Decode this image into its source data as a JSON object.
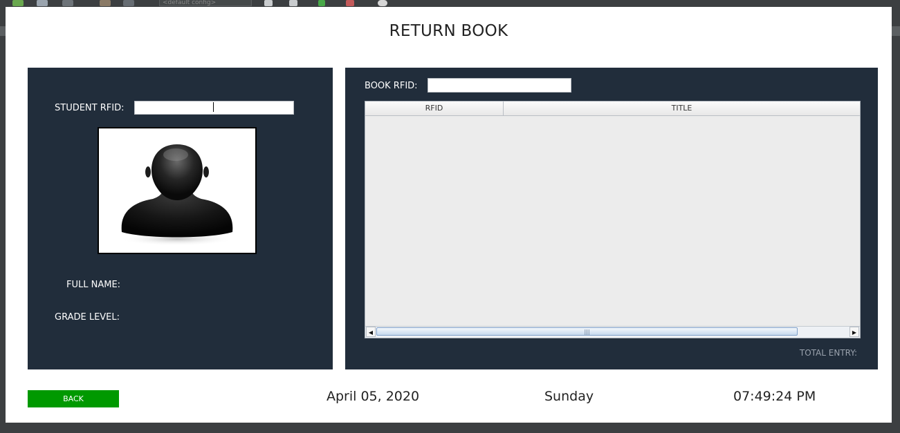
{
  "ide": {
    "config_combo": "<default config>",
    "icons": [
      "new-file-icon",
      "open-project-icon",
      "save-icon",
      "undo-icon",
      "redo-icon",
      "build-icon",
      "clean-build-icon",
      "run-icon",
      "debug-icon",
      "profile-icon"
    ]
  },
  "window": {
    "title": "RETURN BOOK"
  },
  "student_panel": {
    "rfid_label": "STUDENT RFID:",
    "rfid_value": "",
    "photo": "student-avatar-placeholder",
    "full_name_label": "FULL NAME:",
    "full_name_value": "",
    "grade_level_label": "GRADE LEVEL:",
    "grade_level_value": ""
  },
  "book_panel": {
    "rfid_label": "BOOK RFID:",
    "rfid_value": "",
    "table": {
      "columns": [
        "RFID",
        "TITLE"
      ],
      "rows": []
    },
    "total_entry_label": "TOTAL ENTRY:",
    "total_entry_value": ""
  },
  "footer": {
    "back_label": "BACK",
    "date": "April 05, 2020",
    "day": "Sunday",
    "time": "07:49:24 PM"
  },
  "colors": {
    "panel_bg": "#212d3b",
    "back_button": "#009900",
    "window_bg": "#ffffff"
  }
}
